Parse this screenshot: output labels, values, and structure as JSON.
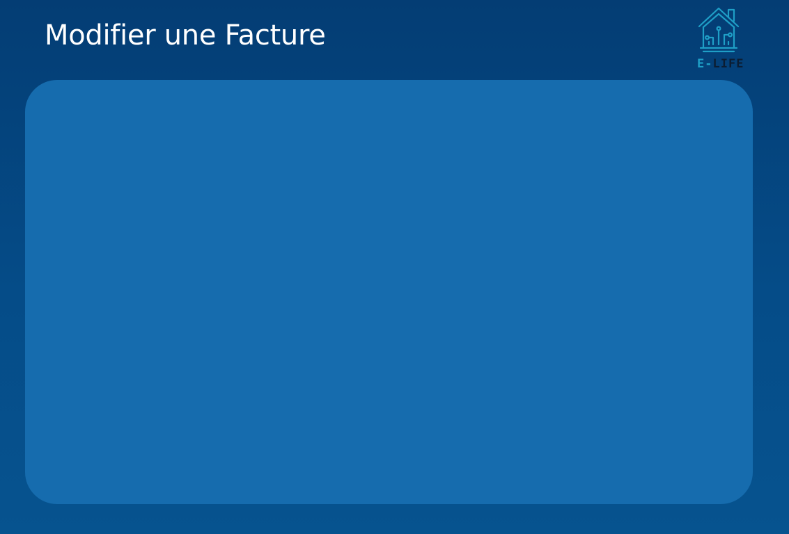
{
  "header": {
    "title": "Modifier une Facture"
  },
  "logo": {
    "icon": "smart-home-circuit-icon",
    "text_prefix": "E-",
    "text_suffix": "LIFE",
    "accent_color": "#1f9fc7",
    "dark_color": "#0b1d33"
  },
  "colors": {
    "background_top": "#043d74",
    "background_bottom": "#06538f",
    "panel": "#166cae",
    "title_text": "#ffffff"
  }
}
